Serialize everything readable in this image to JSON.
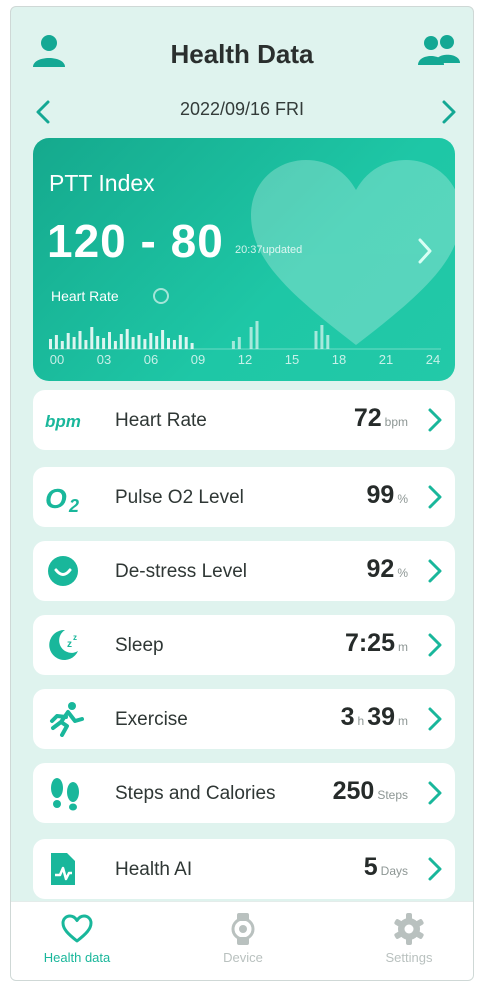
{
  "header": {
    "title": "Health Data",
    "date": "2022/09/16 FRI"
  },
  "ptt": {
    "title": "PTT Index",
    "value": "120 - 80",
    "updated": "20:37updated",
    "hr_label": "Heart Rate",
    "chart_ticks": [
      "00",
      "03",
      "06",
      "09",
      "12",
      "15",
      "18",
      "21",
      "24"
    ]
  },
  "metrics": [
    {
      "label": "Heart Rate",
      "icon": "bpm-icon",
      "num1": "72",
      "unit1": "bpm"
    },
    {
      "label": "Pulse O2 Level",
      "icon": "o2-icon",
      "num1": "99",
      "unit1": "%"
    },
    {
      "label": "De-stress Level",
      "icon": "smiley-icon",
      "num1": "92",
      "unit1": "%"
    },
    {
      "label": "Sleep",
      "icon": "moon-icon",
      "num1": "7:25",
      "unit1": "m"
    },
    {
      "label": "Exercise",
      "icon": "runner-icon",
      "num1": "3",
      "unit1": "h",
      "num2": "39",
      "unit2": "m"
    },
    {
      "label": "Steps and Calories",
      "icon": "footprints-icon",
      "num1": "250",
      "unit1": "Steps"
    },
    {
      "label": "Health AI",
      "icon": "health-report-icon",
      "num1": "5",
      "unit1": "Days"
    }
  ],
  "tabs": [
    {
      "label": "Health data",
      "icon": "heart-icon",
      "active": true
    },
    {
      "label": "Device",
      "icon": "watch-icon",
      "active": false
    },
    {
      "label": "Settings",
      "icon": "gear-icon",
      "active": false
    }
  ],
  "colors": {
    "accent": "#19b79b",
    "card": "#1ec7a6",
    "background": "#dff3ee",
    "inactive_tab": "#b9c1bf"
  }
}
